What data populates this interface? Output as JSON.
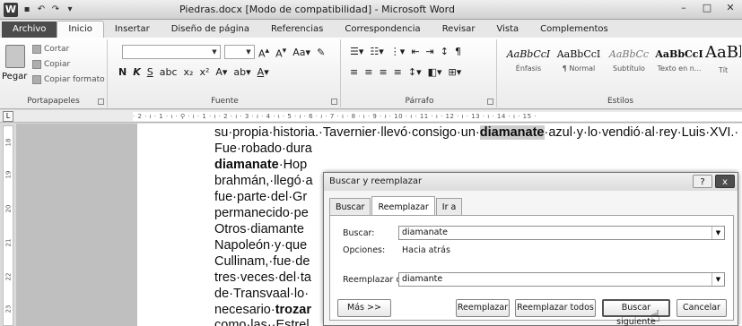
{
  "window": {
    "title": "Piedras.docx [Modo de compatibilidad] - Microsoft Word",
    "app_icon": "W"
  },
  "tabs": [
    "Archivo",
    "Inicio",
    "Insertar",
    "Diseño de página",
    "Referencias",
    "Correspondencia",
    "Revisar",
    "Vista",
    "Complementos"
  ],
  "ribbon": {
    "clipboard": {
      "paste": "Pegar",
      "cut": "Cortar",
      "copy": "Copiar",
      "format_painter": "Copiar formato",
      "group": "Portapapeles"
    },
    "font": {
      "group": "Fuente",
      "font_name": "",
      "font_size": ""
    },
    "paragraph": {
      "group": "Párrafo"
    },
    "styles": {
      "group": "Estilos",
      "items": [
        {
          "sample": "AaBbCcI",
          "name": "Énfasis"
        },
        {
          "sample": "AaBbCcI",
          "name": "¶ Normal"
        },
        {
          "sample": "AaBbCc",
          "name": "Subtítulo"
        },
        {
          "sample": "AaBbCcI",
          "name": "Texto en n..."
        },
        {
          "sample": "AaBbCcI",
          "name": "Tít"
        }
      ]
    }
  },
  "ruler": {
    "marks": "· 2 · ı · 1 · ı · ⚲ · ı · 1 · ı · 2 · ı · 3 · ı · 4 · ı · 5 · ı · 6 · ı · 7 · ı · 8 · ı · 9 · ı · 10 · ı · 11 · ı · 12 · ı · 13 · ı · 14 · ı · 15 ·",
    "vmarks": [
      "18",
      "19",
      "20",
      "21",
      "22",
      "23"
    ]
  },
  "document": {
    "line1_a": "su·propia·historia.·Tavernier·llevó·consigo·un·",
    "line1_hl": "diamanate",
    "line1_b": "·azul·y·lo·vendió·al·rey·Luis·XVI.·",
    "line2": "Fue·robado·dura",
    "line3_hl": "diamanate",
    "line3_b": "·Hop",
    "line4": "brahmán,·llegó·a",
    "line5": "fue·parte·del·Gr",
    "line6": "permanecido·pe",
    "line7": "Otros·diamante",
    "line8": "Napoleón·y·que",
    "line9": "Cullinam,·fue·de",
    "line10": "tres·veces·del·ta",
    "line11": "de·Transvaal·lo·",
    "line12_a": "necesario·",
    "line12_b": "trozar",
    "line13": "como·las··Estrel"
  },
  "dialog": {
    "title": "Buscar y reemplazar",
    "help": "?",
    "close": "x",
    "tabs": [
      "Buscar",
      "Reemplazar",
      "Ir a"
    ],
    "find_label": "Buscar:",
    "find_value": "diamanate",
    "options_label": "Opciones:",
    "options_value": "Hacia atrás",
    "replace_label": "Reemplazar con:",
    "replace_value": "diamante",
    "buttons": {
      "more": "Más >>",
      "replace": "Reemplazar",
      "replace_all": "Reemplazar todos",
      "find_next": "Buscar siguiente",
      "cancel": "Cancelar"
    }
  }
}
